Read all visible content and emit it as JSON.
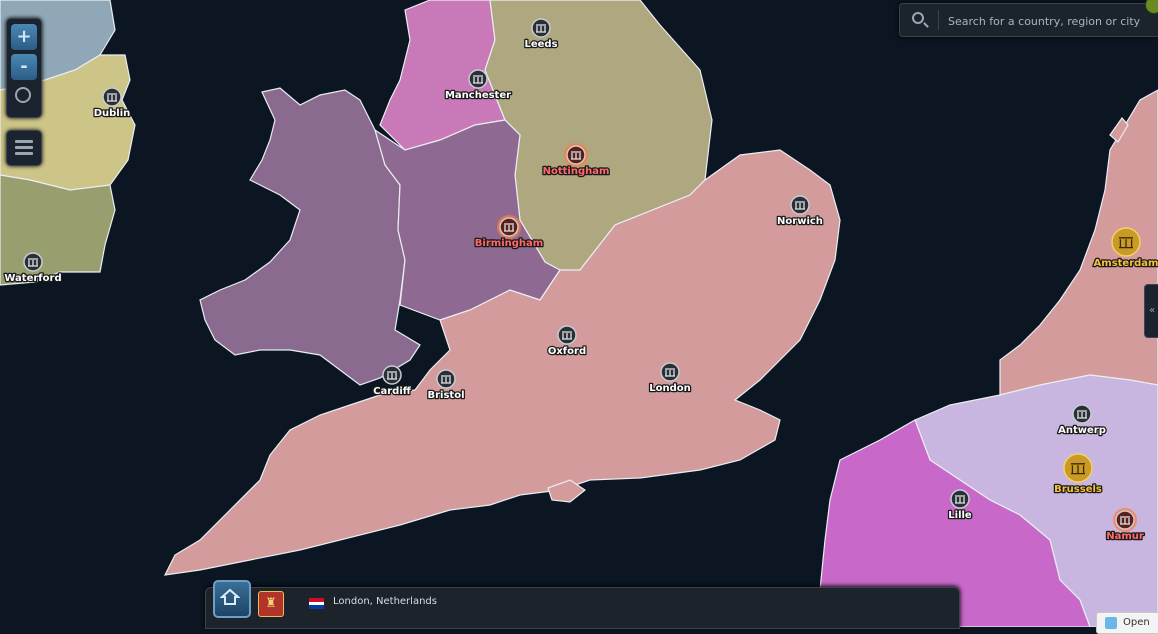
{
  "search": {
    "placeholder": "Search for a country, region or city"
  },
  "zoom": {
    "in_label": "+",
    "out_label": "-"
  },
  "cities": [
    {
      "name": "Leeds",
      "style": "normal"
    },
    {
      "name": "Manchester",
      "style": "normal"
    },
    {
      "name": "Dublin",
      "style": "normal"
    },
    {
      "name": "Nottingham",
      "style": "capital"
    },
    {
      "name": "Norwich",
      "style": "normal"
    },
    {
      "name": "Birmingham",
      "style": "capital"
    },
    {
      "name": "Waterford",
      "style": "normal"
    },
    {
      "name": "Amsterdam",
      "style": "gold"
    },
    {
      "name": "Oxford",
      "style": "normal"
    },
    {
      "name": "London",
      "style": "normal"
    },
    {
      "name": "Cardiff",
      "style": "normal"
    },
    {
      "name": "Bristol",
      "style": "normal"
    },
    {
      "name": "Antwerp",
      "style": "normal"
    },
    {
      "name": "Brussels",
      "style": "gold"
    },
    {
      "name": "Lille",
      "style": "normal"
    },
    {
      "name": "Namur",
      "style": "capital"
    }
  ],
  "bottom_bar": {
    "location": "London, Netherlands"
  },
  "open_button": {
    "label": "Open"
  },
  "colors": {
    "sea": "#0b1622",
    "south_england": "#d39b9b",
    "midlands": "#8e6a92",
    "wales": "#8a6a8e",
    "north_west": "#c979b8",
    "north_east": "#aea77f",
    "ireland_east": "#cdc488",
    "ireland_south": "#999e6f",
    "ireland_north": "#8fa7b6",
    "belgium": "#c8b5e0",
    "france_north": "#c868c8",
    "netherlands": "#d39b9b"
  }
}
